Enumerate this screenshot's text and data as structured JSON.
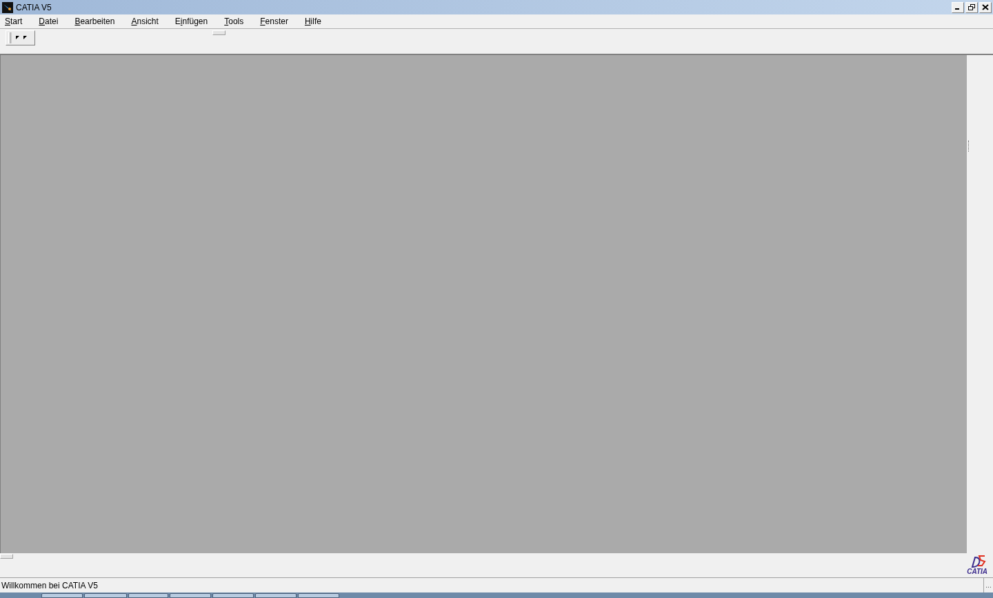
{
  "window": {
    "title": "CATIA V5"
  },
  "menu": [
    {
      "key": "S",
      "post": "tart"
    },
    {
      "key": "D",
      "post": "atei"
    },
    {
      "key": "B",
      "post": "earbeiten"
    },
    {
      "key": "A",
      "post": "nsicht"
    },
    {
      "pre": "E",
      "key": "i",
      "post": "nfügen"
    },
    {
      "key": "T",
      "post": "ools"
    },
    {
      "key": "F",
      "post": "enster"
    },
    {
      "key": "H",
      "post": "ilfe"
    }
  ],
  "logo": {
    "text": "CATIA"
  },
  "status_bar": {
    "message": "Willkommen bei CATIA V5",
    "grip": "..."
  }
}
